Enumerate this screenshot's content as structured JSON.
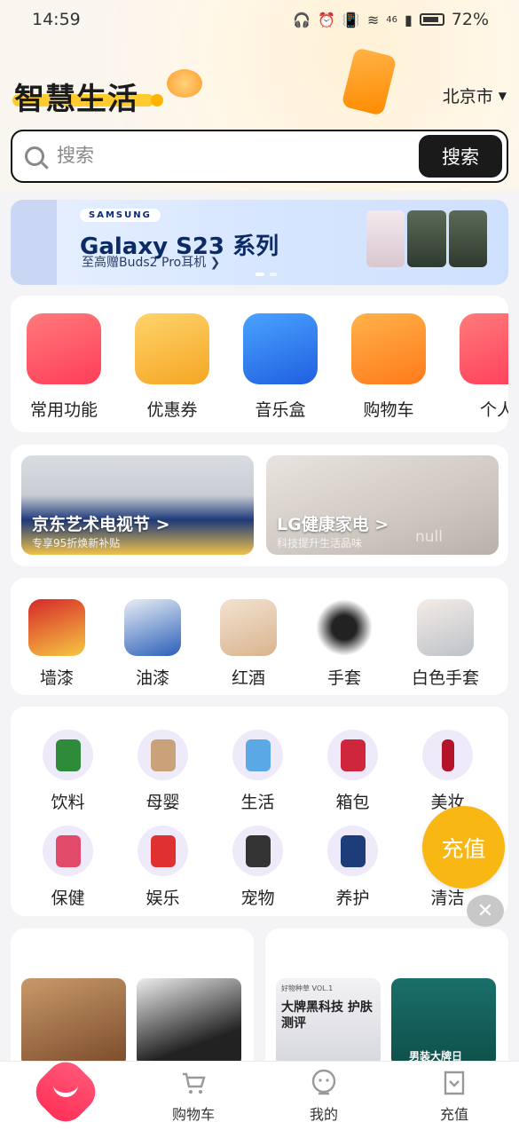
{
  "status_bar": {
    "time": "14:59",
    "network": "46",
    "battery": "72%"
  },
  "header": {
    "logo_text": "智慧生活",
    "city": "北京市"
  },
  "search": {
    "placeholder": "搜索",
    "button_label": "搜索"
  },
  "banner": {
    "brand": "SAMSUNG",
    "title": "Galaxy S23 系列",
    "subtitle": "至高赠Buds2 Pro耳机 ❯"
  },
  "quick_functions": [
    {
      "label": "常用功能",
      "icon": "gift-box-icon"
    },
    {
      "label": "优惠券",
      "icon": "coupon-icon"
    },
    {
      "label": "音乐盒",
      "icon": "music-box-icon"
    },
    {
      "label": "购物车",
      "icon": "shopping-cart-icon"
    },
    {
      "label": "个人",
      "icon": "gift-box-icon"
    }
  ],
  "promos": [
    {
      "title": "京东艺术电视节 >",
      "subtitle": "专享95折焕新补贴"
    },
    {
      "title": "LG健康家电 >",
      "subtitle": "科技提升生活品味",
      "overlay": "null"
    }
  ],
  "categories_top": [
    {
      "label": "墙漆"
    },
    {
      "label": "油漆"
    },
    {
      "label": "红酒"
    },
    {
      "label": "手套"
    },
    {
      "label": "白色手套"
    }
  ],
  "categories_grid": [
    {
      "label": "饮料"
    },
    {
      "label": "母婴"
    },
    {
      "label": "生活"
    },
    {
      "label": "箱包"
    },
    {
      "label": "美妆"
    },
    {
      "label": "保健"
    },
    {
      "label": "娱乐"
    },
    {
      "label": "宠物"
    },
    {
      "label": "养护"
    },
    {
      "label": "清洁"
    }
  ],
  "floating": {
    "recharge_label": "充值",
    "close_symbol": "✕"
  },
  "feed": {
    "right_card_1_small": "好物种草 VOL.1",
    "right_card_1_title": "大牌黑科技 护肤测评",
    "right_card_2_title": "男装大牌日"
  },
  "tabbar": {
    "tabs": [
      {
        "label": "",
        "icon": "home-smile-icon"
      },
      {
        "label": "购物车",
        "icon": "cart-icon"
      },
      {
        "label": "我的",
        "icon": "profile-icon"
      },
      {
        "label": "充值",
        "icon": "recharge-icon"
      }
    ]
  },
  "colors": {
    "accent_yellow": "#f9b713",
    "home_pink": "#ff2d55",
    "search_button_bg": "#1a1a1a"
  }
}
